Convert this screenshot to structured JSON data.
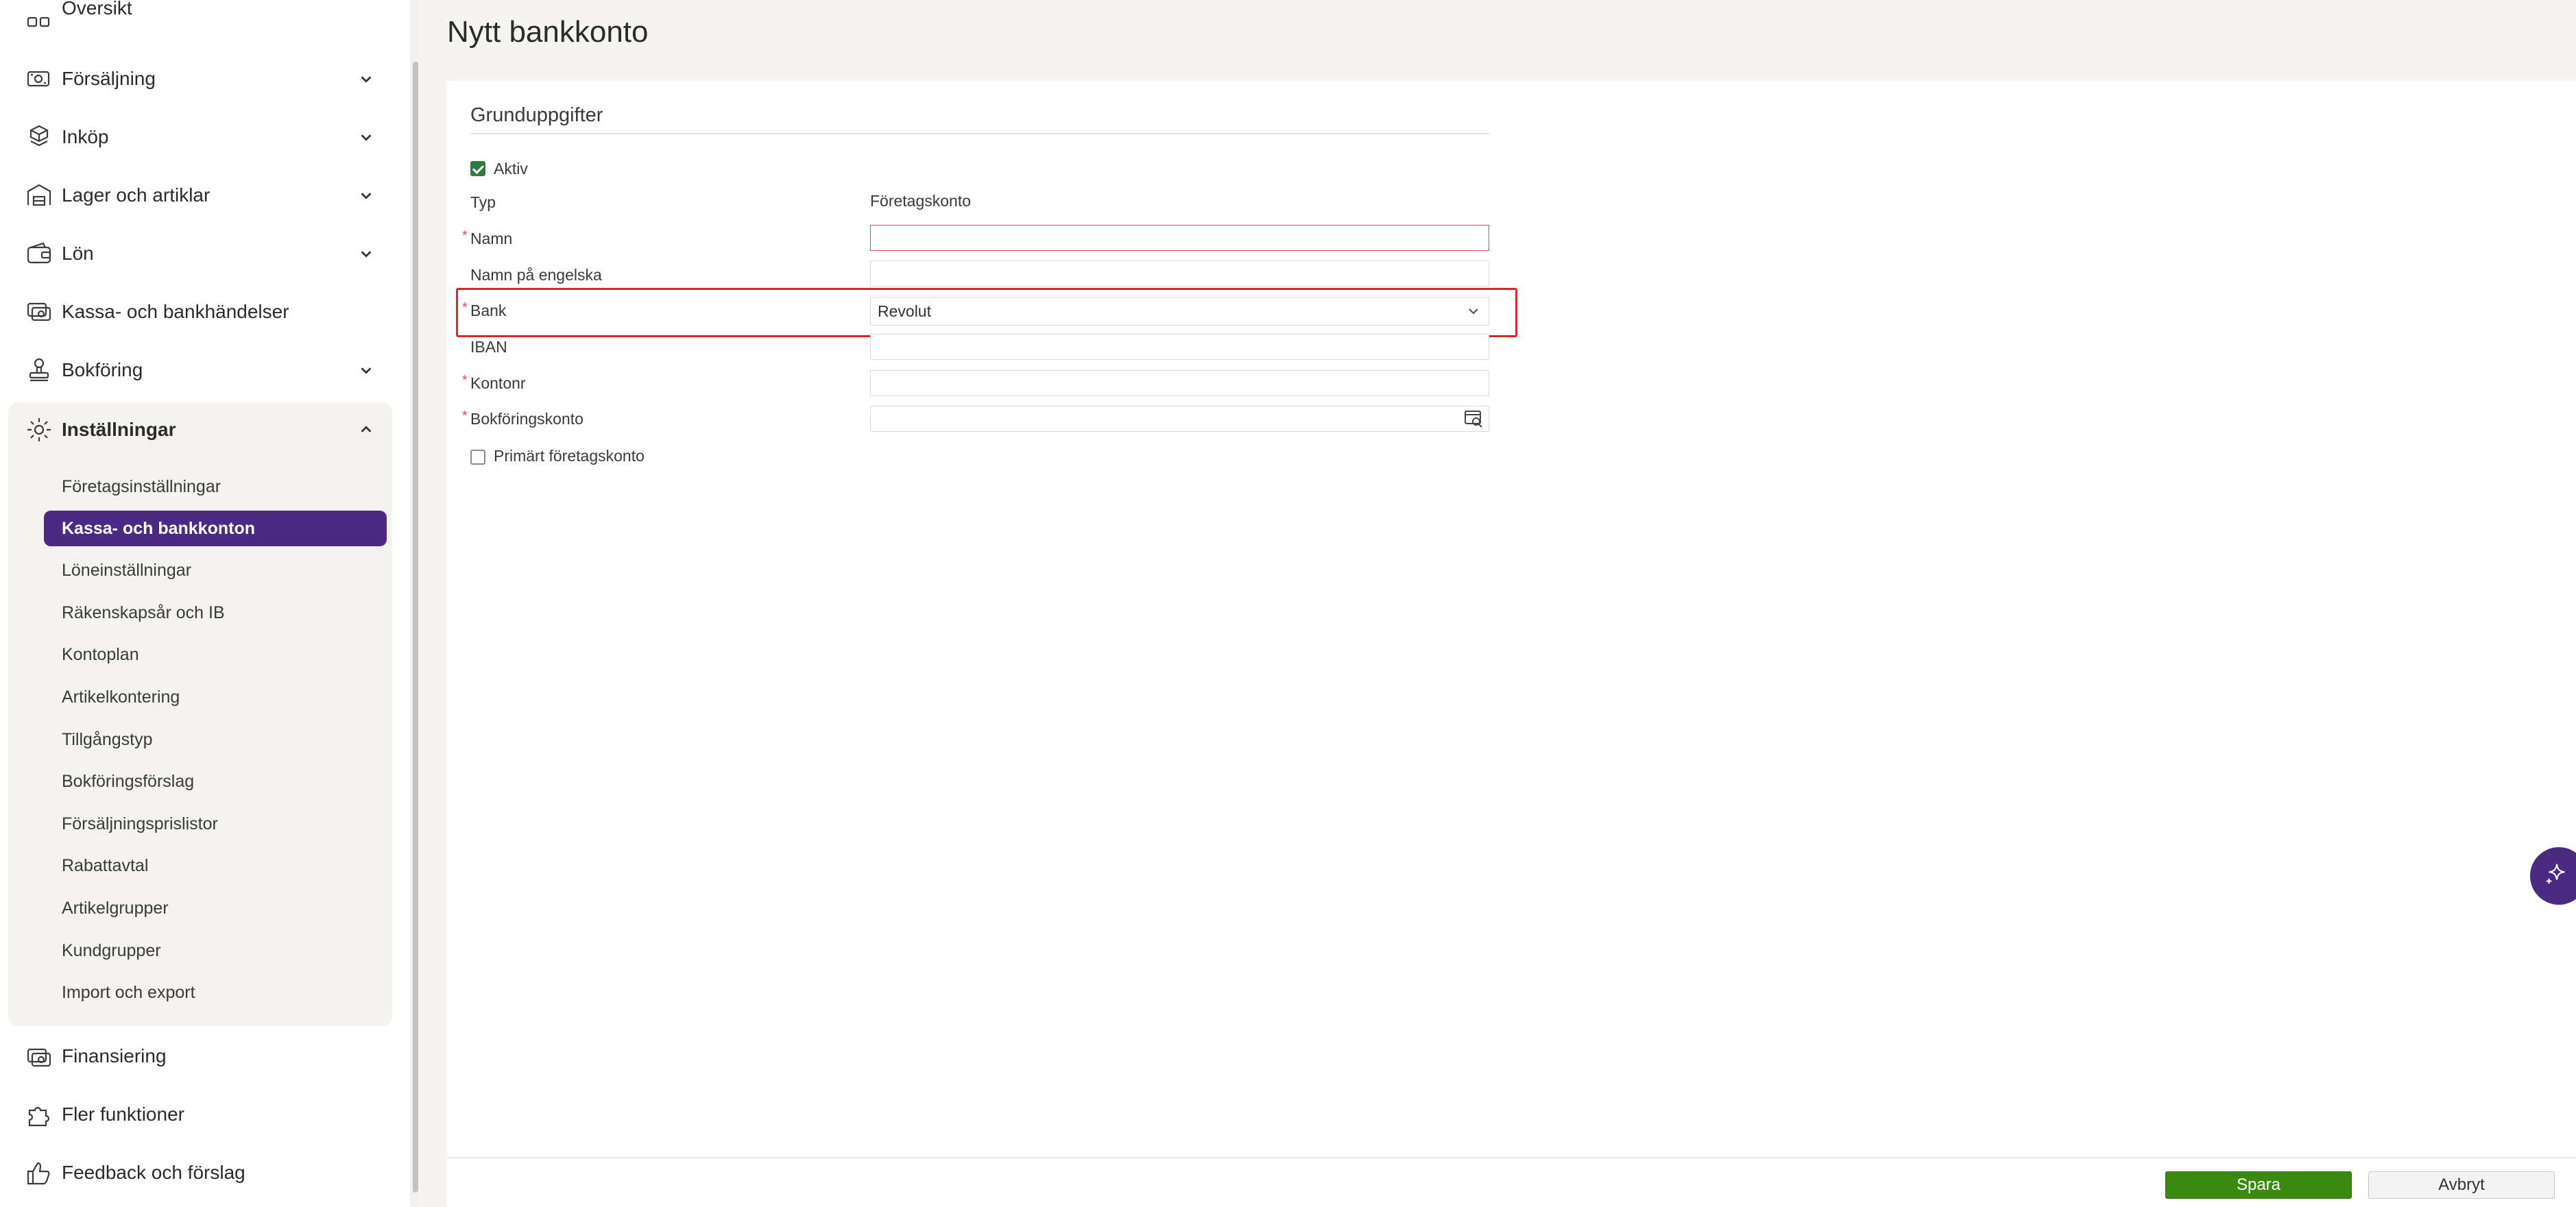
{
  "sidebar": {
    "items": [
      {
        "label": "Översikt",
        "icon": "grid-icon"
      },
      {
        "label": "Försäljning",
        "icon": "cash-icon"
      },
      {
        "label": "Inköp",
        "icon": "boxes-icon"
      },
      {
        "label": "Lager och artiklar",
        "icon": "warehouse-icon"
      },
      {
        "label": "Lön",
        "icon": "wallet-icon"
      },
      {
        "label": "Kassa- och bankhändelser",
        "icon": "cash-register-icon"
      },
      {
        "label": "Bokföring",
        "icon": "stamp-icon"
      },
      {
        "label": "Inställningar",
        "icon": "gear-icon"
      }
    ],
    "settings_sub": [
      "Företagsinställningar",
      "Kassa- och bankkonton",
      "Löneinställningar",
      "Räkenskapsår och IB",
      "Kontoplan",
      "Artikelkontering",
      "Tillgångstyp",
      "Bokföringsförslag",
      "Försäljningsprislistor",
      "Rabattavtal",
      "Artikelgrupper",
      "Kundgrupper",
      "Import och export"
    ],
    "bottom_items": [
      {
        "label": "Finansiering",
        "icon": "money-icon"
      },
      {
        "label": "Fler funktioner",
        "icon": "puzzle-icon"
      },
      {
        "label": "Feedback och förslag",
        "icon": "thumbs-up-icon"
      }
    ]
  },
  "page": {
    "title": "Nytt bankkonto",
    "section_title": "Grunduppgifter"
  },
  "form": {
    "aktiv_label": "Aktiv",
    "aktiv_checked": true,
    "typ_label": "Typ",
    "typ_value": "Företagskonto",
    "namn_label": "Namn",
    "namn_value": "",
    "namn_en_label": "Namn på engelska",
    "namn_en_value": "",
    "bank_label": "Bank",
    "bank_value": "Revolut",
    "iban_label": "IBAN",
    "iban_value": "",
    "kontonr_label": "Kontonr",
    "kontonr_value": "",
    "bokforingskonto_label": "Bokföringskonto",
    "bokforingskonto_value": "",
    "primart_label": "Primärt företagskonto",
    "primart_checked": false,
    "required_marker": "*"
  },
  "footer": {
    "save_label": "Spara",
    "cancel_label": "Avbryt"
  },
  "colors": {
    "accent_purple": "#4b2a84",
    "primary_green": "#3c8a0f",
    "error_red": "#e0252f"
  }
}
